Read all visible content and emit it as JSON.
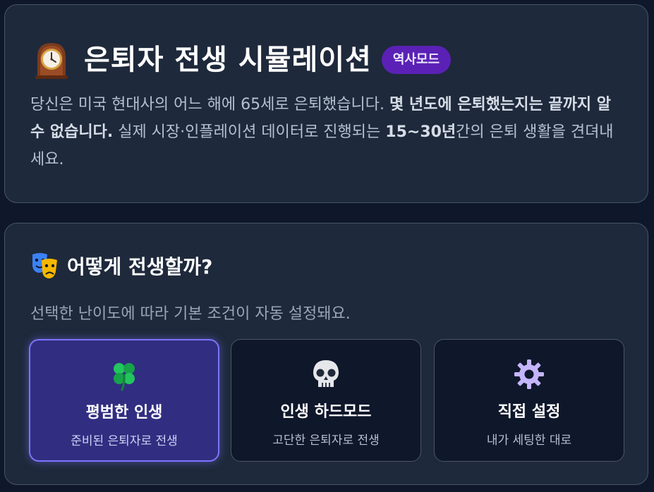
{
  "hero": {
    "title": "은퇴자 전생 시뮬레이션",
    "badge": "역사모드",
    "desc_part1": "당신은 미국 현대사의 어느 해에 65세로 은퇴했습니다. ",
    "desc_bold1": "몇 년도에 은퇴했는지는 끝까지 알 수 없습니다.",
    "desc_part2": " 실제 시장·인플레이션 데이터로 진행되는 ",
    "desc_bold2": "15~30년",
    "desc_part3": "간의 은퇴 생활을 견뎌내세요."
  },
  "mode": {
    "title": "어떻게 전생할까?",
    "subtitle": "선택한 난이도에 따라 기본 조건이 자동 설정돼요.",
    "options": [
      {
        "icon": "four-leaf-clover-icon",
        "title": "평범한 인생",
        "desc": "준비된 은퇴자로 전생",
        "selected": true
      },
      {
        "icon": "skull-icon",
        "title": "인생 하드모드",
        "desc": "고단한 은퇴자로 전생",
        "selected": false
      },
      {
        "icon": "gear-icon",
        "title": "직접 설정",
        "desc": "내가 세팅한 대로",
        "selected": false
      }
    ]
  },
  "colors": {
    "background": "#0f172a",
    "card": "#1e293b",
    "badge": "#5b21b6",
    "selected_border": "#7c74ff",
    "selected_fill": "#312e81"
  }
}
